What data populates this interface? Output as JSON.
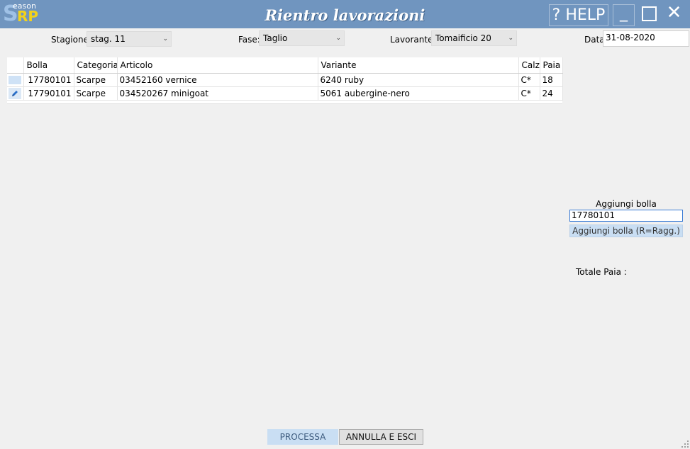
{
  "app": {
    "logo_small": "eason",
    "logo_s": "S",
    "logo_rp": "RP",
    "title": "Rientro lavorazioni",
    "help_label": "? HELP",
    "minimize_glyph": "_",
    "close_glyph": "✕"
  },
  "filters": {
    "stagione_label": "Stagione",
    "stagione_value": "stag. 11",
    "fase_label": "Fase:",
    "fase_value": "Taglio",
    "lavorante_label": "Lavorante:",
    "lavorante_value": "Tomaificio 20",
    "data_label": "Data",
    "data_value": "31-08-2020"
  },
  "grid": {
    "columns": [
      "Bolla",
      "Categoria",
      "Articolo",
      "Variante",
      "Calz",
      "Paia"
    ],
    "rows": [
      {
        "bolla": "17780101",
        "categoria": "Scarpe",
        "articolo": "03452160 vernice",
        "variante": "6240 ruby",
        "calz": "C*",
        "paia": "18"
      },
      {
        "bolla": "17790101",
        "categoria": "Scarpe",
        "articolo": "034520267 minigoat",
        "variante": "5061 aubergine-nero",
        "calz": "C*",
        "paia": "24"
      }
    ]
  },
  "side": {
    "aggiungi_label": "Aggiungi bolla",
    "aggiungi_input": "17780101",
    "aggiungi_button": "Aggiungi bolla (R=Ragg.)",
    "totale_label": "Totale Paia :"
  },
  "actions": {
    "processa": "PROCESSA",
    "annulla": "ANNULLA E ESCI"
  },
  "colors": {
    "titlebar": "#7095bf",
    "accent": "#c9def3",
    "logo_yellow": "#f3d21b"
  }
}
